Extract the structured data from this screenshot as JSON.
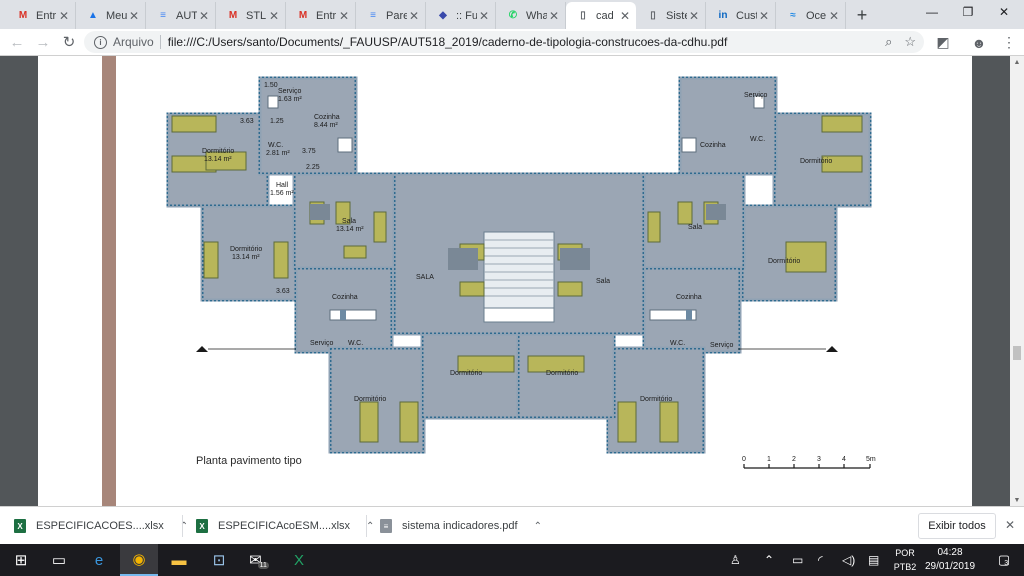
{
  "browser": {
    "tabs": [
      {
        "label": "Entr",
        "icon": "gmail-icon",
        "color": "#d93025",
        "glyph": "M"
      },
      {
        "label": "Meu",
        "icon": "drive-icon",
        "color": "#1a73e8",
        "glyph": "▲"
      },
      {
        "label": "AUT",
        "icon": "docs-icon",
        "color": "#4285f4",
        "glyph": "≡"
      },
      {
        "label": "STL",
        "icon": "gmail-icon",
        "color": "#d93025",
        "glyph": "M"
      },
      {
        "label": "Entr",
        "icon": "gmail-icon",
        "color": "#d93025",
        "glyph": "M"
      },
      {
        "label": "Pare",
        "icon": "docs-icon",
        "color": "#4285f4",
        "glyph": "≡"
      },
      {
        "label": ":: Fu",
        "icon": "moodle-icon",
        "color": "#3949ab",
        "glyph": "◆"
      },
      {
        "label": "Wha",
        "icon": "whatsapp-icon",
        "color": "#25d366",
        "glyph": "✆"
      },
      {
        "label": "cad",
        "icon": "file-icon",
        "color": "#5f6368",
        "glyph": "▯",
        "active": true
      },
      {
        "label": "Siste",
        "icon": "file-icon",
        "color": "#5f6368",
        "glyph": "▯"
      },
      {
        "label": "Cust",
        "icon": "linkedin-icon",
        "color": "#0a66c2",
        "glyph": "in"
      },
      {
        "label": "Oce",
        "icon": "ocean-icon",
        "color": "#1e88e5",
        "glyph": "≈"
      }
    ],
    "new_tab": "+",
    "address": {
      "scheme": "Arquivo",
      "url": "file:///C:/Users/santo/Documents/_FAUUSP/AUT518_2019/caderno-de-tipologia-construcoes-da-cdhu.pdf"
    }
  },
  "pdf": {
    "caption": "Planta pavimento tipo",
    "rooms": {
      "servico": "Serviço",
      "servico_area": "1.63 m²",
      "cozinha": "Cozinha",
      "cozinha_area": "8.44 m²",
      "dormitorio": "Dormitório",
      "dormitorio_area": "13.14 m²",
      "wc": "W.C.",
      "wc_area": "2.81 m²",
      "hall": "Hall",
      "hall_area": "1.56 m²",
      "sala": "Sala",
      "sala_area": "13.14 m²",
      "sala_caps": "SALA"
    },
    "dims": {
      "d363": "3.63",
      "d125": "1.25",
      "d225": "2.25",
      "d375": "3.75",
      "d63": "3.63",
      "d150": "1.50"
    },
    "scale": {
      "labels": [
        "0",
        "1",
        "2",
        "3",
        "4",
        "5m"
      ]
    }
  },
  "downloads": {
    "items": [
      {
        "name": "ESPECIFICACOES....xlsx",
        "type": "excel"
      },
      {
        "name": "ESPECIFICAcoESM....xlsx",
        "type": "excel"
      },
      {
        "name": "sistema indicadores.pdf",
        "type": "pdf"
      }
    ],
    "show_all": "Exibir todos"
  },
  "taskbar": {
    "language": {
      "line1": "POR",
      "line2": "PTB2"
    },
    "time": "04:28",
    "date": "29/01/2019",
    "mail_badge": "11",
    "notifications": "3"
  }
}
